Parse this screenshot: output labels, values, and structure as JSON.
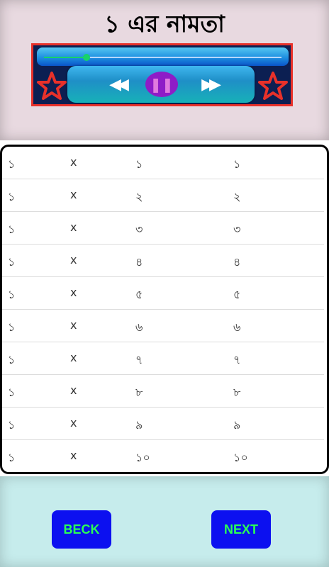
{
  "header": {
    "title": "১ এর নামতা"
  },
  "player": {
    "progress": 0.18,
    "rewind_icon": "◀◀",
    "pause_icon": "❚❚",
    "forward_icon": "▶▶",
    "star_color": "#e8312a"
  },
  "table": {
    "rows": [
      {
        "a": "১",
        "op": "x",
        "b": "১",
        "result": "১"
      },
      {
        "a": "১",
        "op": "x",
        "b": "২",
        "result": "২"
      },
      {
        "a": "১",
        "op": "x",
        "b": "৩",
        "result": "৩"
      },
      {
        "a": "১",
        "op": "x",
        "b": "৪",
        "result": "৪"
      },
      {
        "a": "১",
        "op": "x",
        "b": "৫",
        "result": "৫"
      },
      {
        "a": "১",
        "op": "x",
        "b": "৬",
        "result": "৬"
      },
      {
        "a": "১",
        "op": "x",
        "b": "৭",
        "result": "৭"
      },
      {
        "a": "১",
        "op": "x",
        "b": "৮",
        "result": "৮"
      },
      {
        "a": "১",
        "op": "x",
        "b": "৯",
        "result": "৯"
      },
      {
        "a": "১",
        "op": "x",
        "b": "১০",
        "result": "১০"
      }
    ]
  },
  "footer": {
    "back_label": "BECK",
    "next_label": "NEXT"
  }
}
